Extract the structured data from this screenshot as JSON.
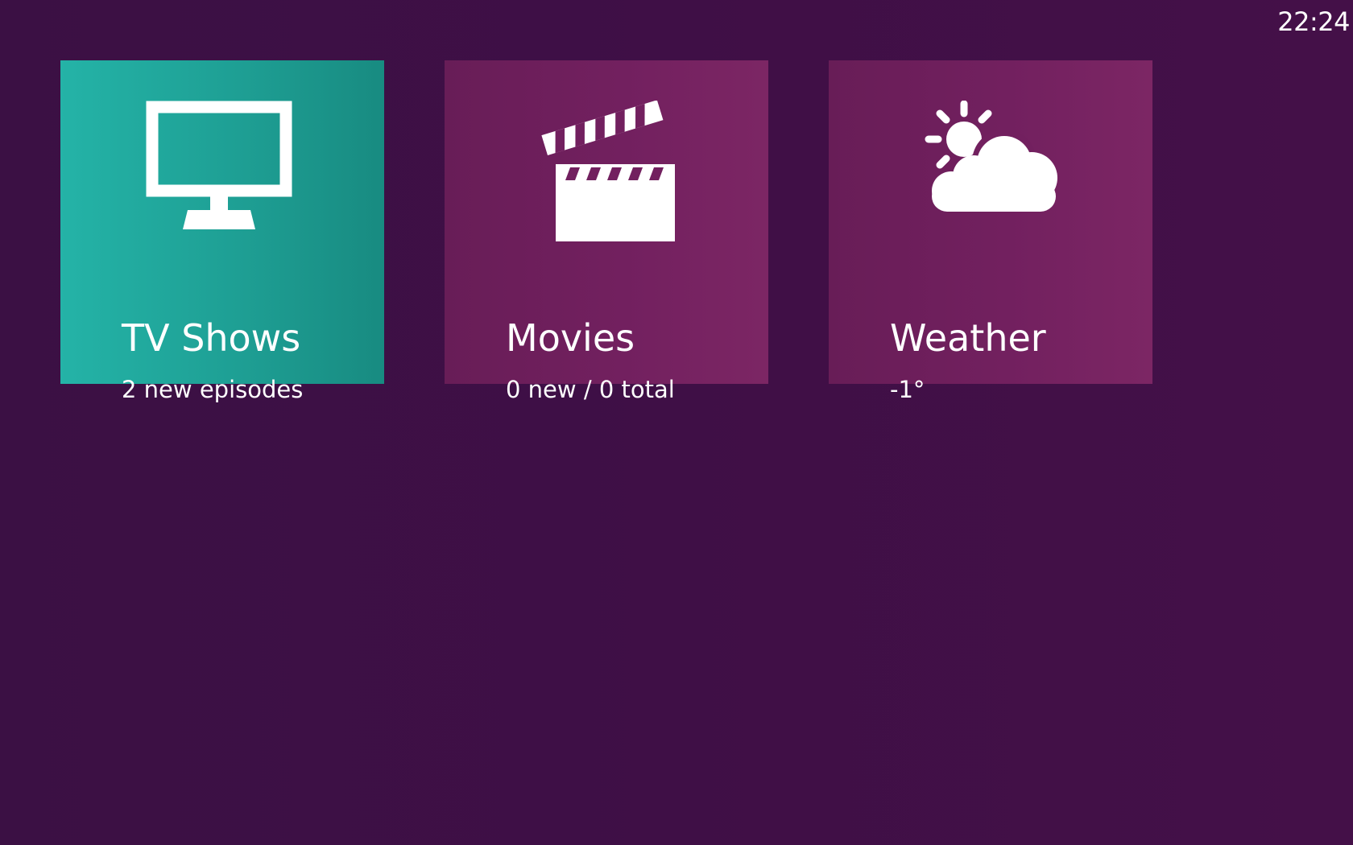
{
  "clock": "22:24",
  "tiles": [
    {
      "title": "TV Shows",
      "subtitle": "2 new episodes",
      "icon": "tv-icon",
      "color": "#24b3a7"
    },
    {
      "title": "Movies",
      "subtitle": "0 new / 0 total",
      "icon": "clapperboard-icon",
      "color": "#72205f"
    },
    {
      "title": "Weather",
      "subtitle": "-1°",
      "icon": "partly-cloudy-icon",
      "color": "#72205f"
    }
  ]
}
